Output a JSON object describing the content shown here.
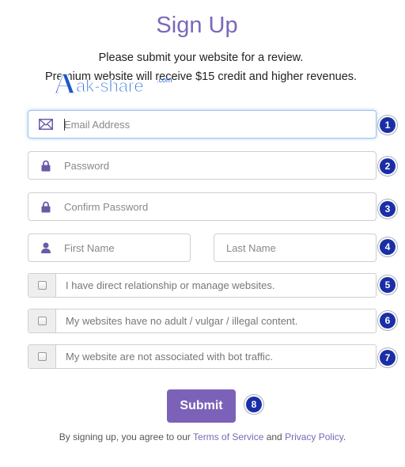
{
  "header": {
    "title": "Sign Up",
    "line1": "Please submit your website for a review.",
    "line2": "Premium website will receive $15 credit and higher revenues."
  },
  "watermark": {
    "text": "ak-share",
    "initial": "A",
    "suffix": ".com"
  },
  "fields": {
    "email": {
      "placeholder": "Email Address",
      "icon": "envelope-icon"
    },
    "password": {
      "placeholder": "Password",
      "icon": "lock-icon"
    },
    "confirm_password": {
      "placeholder": "Confirm Password",
      "icon": "lock-icon"
    },
    "first_name": {
      "placeholder": "First Name",
      "icon": "user-icon"
    },
    "last_name": {
      "placeholder": "Last Name"
    }
  },
  "checkboxes": [
    {
      "label": "I have direct relationship or manage websites.",
      "checked": false
    },
    {
      "label": "My websites have no adult / vulgar / illegal content.",
      "checked": false
    },
    {
      "label": "My website are not associated with bot traffic.",
      "checked": false
    }
  ],
  "badges": [
    "1",
    "2",
    "3",
    "4",
    "5",
    "6",
    "7",
    "8"
  ],
  "submit": {
    "label": "Submit"
  },
  "footer": {
    "prefix": "By signing up, you agree to our ",
    "terms": "Terms of Service",
    "and": " and ",
    "privacy": "Privacy Policy",
    "suffix": "."
  },
  "colors": {
    "accent": "#7b62b8",
    "badge": "#1a2fa6",
    "focus": "#9ec3ee"
  }
}
